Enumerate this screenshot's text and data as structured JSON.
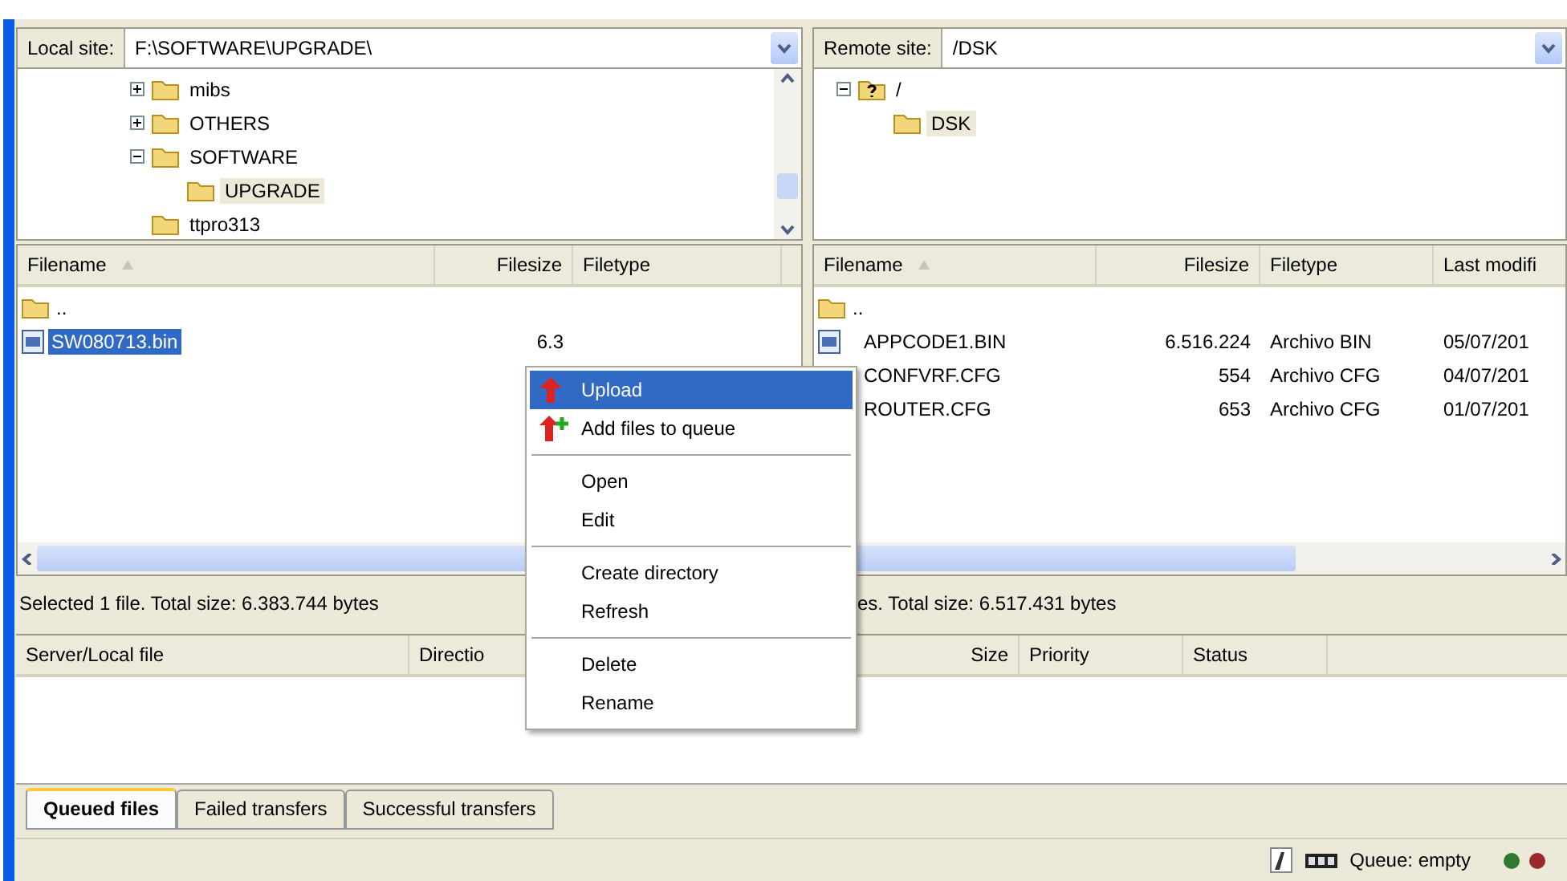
{
  "local": {
    "site_label": "Local site:",
    "path": "F:\\SOFTWARE\\UPGRADE\\",
    "tree": [
      {
        "label": "mibs",
        "expanded": false,
        "selected": false
      },
      {
        "label": "OTHERS",
        "expanded": false,
        "selected": false
      },
      {
        "label": "SOFTWARE",
        "expanded": true,
        "selected": false,
        "children": [
          {
            "label": "UPGRADE",
            "selected": true
          }
        ]
      },
      {
        "label": "ttpro313",
        "selected": false
      }
    ],
    "columns": [
      {
        "label": "Filename",
        "sorted": true
      },
      {
        "label": "Filesize",
        "sorted": false
      },
      {
        "label": "Filetype",
        "sorted": false
      }
    ],
    "rows": [
      {
        "kind": "folder",
        "name": "..",
        "selected": false
      },
      {
        "kind": "file",
        "name": "SW080713.bin",
        "size": "6.3",
        "selected": true
      }
    ],
    "status": "Selected 1 file. Total size: 6.383.744 bytes"
  },
  "remote": {
    "site_label": "Remote site:",
    "path": "/DSK",
    "tree": [
      {
        "label": "/",
        "kind": "unknown",
        "expanded": true,
        "selected": false,
        "children": [
          {
            "label": "DSK",
            "selected": true
          }
        ]
      }
    ],
    "columns": [
      {
        "label": "Filename",
        "sorted": true
      },
      {
        "label": "Filesize",
        "sorted": false
      },
      {
        "label": "Filetype",
        "sorted": false
      },
      {
        "label": "Last modifi",
        "sorted": false
      }
    ],
    "rows": [
      {
        "kind": "folder",
        "name": "..",
        "selected": false
      },
      {
        "kind": "file",
        "name": "APPCODE1.BIN",
        "size": "6.516.224",
        "type": "Archivo BIN",
        "modified": "05/07/201",
        "selected": false
      },
      {
        "kind": "file",
        "name": "CONFVRF.CFG",
        "size": "554",
        "type": "Archivo CFG",
        "modified": "04/07/201",
        "selected": false
      },
      {
        "kind": "file",
        "name": "ROUTER.CFG",
        "size": "653",
        "type": "Archivo CFG",
        "modified": "01/07/201",
        "selected": false
      }
    ],
    "status": "es. Total size: 6.517.431 bytes"
  },
  "queue": {
    "columns": [
      {
        "label": "Server/Local file"
      },
      {
        "label": "Directio"
      },
      {
        "label": "Size"
      },
      {
        "label": "Priority"
      },
      {
        "label": "Status"
      }
    ]
  },
  "tabs": [
    {
      "label": "Queued files",
      "selected": true
    },
    {
      "label": "Failed transfers",
      "selected": false
    },
    {
      "label": "Successful transfers",
      "selected": false
    }
  ],
  "status_bar": {
    "queue": "Queue: empty"
  },
  "context_menu": [
    {
      "kind": "upload",
      "label": "Upload",
      "selected": true
    },
    {
      "kind": "queue",
      "label": "Add files to queue",
      "selected": false
    },
    {
      "kind": "separator"
    },
    {
      "kind": "plain",
      "label": "Open",
      "selected": false
    },
    {
      "kind": "plain",
      "label": "Edit",
      "selected": false
    },
    {
      "kind": "separator"
    },
    {
      "kind": "plain",
      "label": "Create directory",
      "selected": false
    },
    {
      "kind": "plain",
      "label": "Refresh",
      "selected": false
    },
    {
      "kind": "separator"
    },
    {
      "kind": "plain",
      "label": "Delete",
      "selected": false
    },
    {
      "kind": "plain",
      "label": "Rename",
      "selected": false
    }
  ]
}
